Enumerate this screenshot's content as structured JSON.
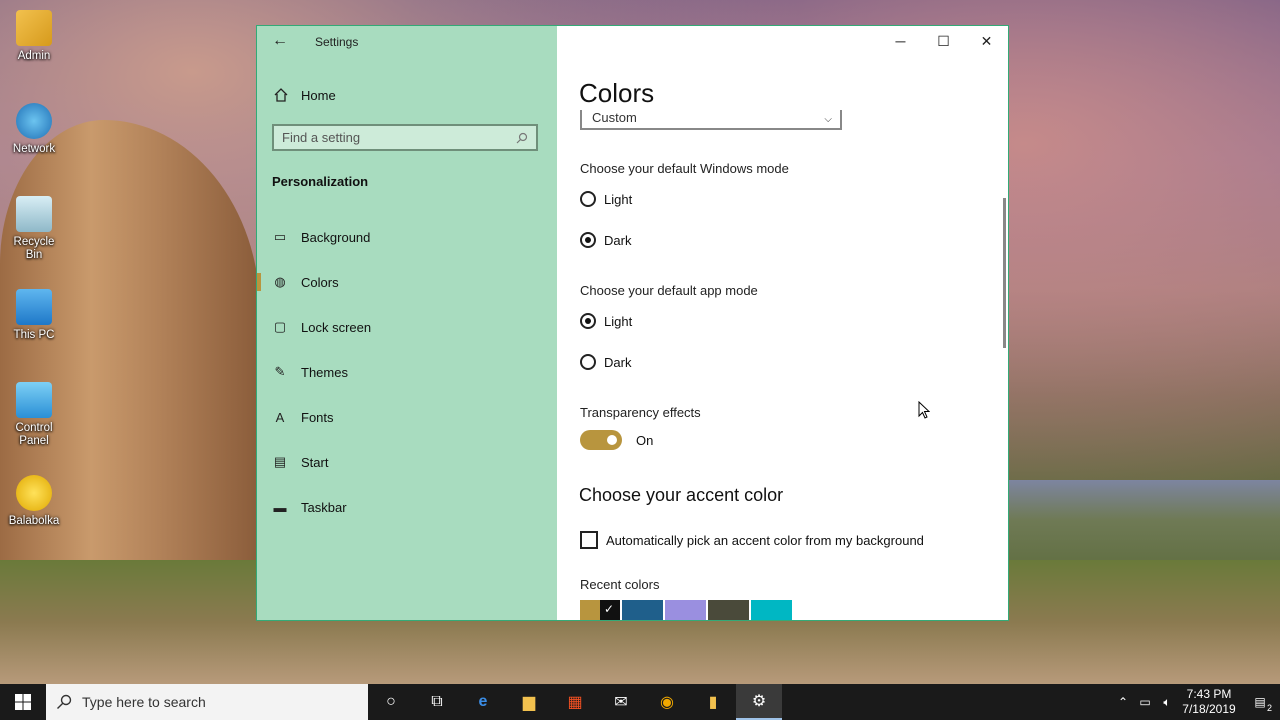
{
  "desktop": {
    "icons": [
      {
        "label": "Admin"
      },
      {
        "label": "Network"
      },
      {
        "label": "Recycle Bin"
      },
      {
        "label": "This PC"
      },
      {
        "label": "Control Panel"
      },
      {
        "label": "Balabolka"
      }
    ]
  },
  "window": {
    "title": "Settings",
    "sidebar": {
      "home_label": "Home",
      "search_placeholder": "Find a setting",
      "section_title": "Personalization",
      "items": [
        {
          "label": "Background",
          "icon": "image-icon"
        },
        {
          "label": "Colors",
          "icon": "palette-icon",
          "active": true
        },
        {
          "label": "Lock screen",
          "icon": "lock-screen-icon"
        },
        {
          "label": "Themes",
          "icon": "brush-icon"
        },
        {
          "label": "Fonts",
          "icon": "font-icon"
        },
        {
          "label": "Start",
          "icon": "start-icon"
        },
        {
          "label": "Taskbar",
          "icon": "taskbar-icon"
        }
      ]
    },
    "main": {
      "heading": "Colors",
      "dropdown_value": "Custom",
      "windows_mode": {
        "label": "Choose your default Windows mode",
        "options": [
          "Light",
          "Dark"
        ],
        "selected": "Dark"
      },
      "app_mode": {
        "label": "Choose your default app mode",
        "options": [
          "Light",
          "Dark"
        ],
        "selected": "Light"
      },
      "transparency": {
        "label": "Transparency effects",
        "state": "On"
      },
      "accent_heading": "Choose your accent color",
      "auto_pick_label": "Automatically pick an accent color from my background",
      "recent_colors_label": "Recent colors",
      "recent_colors": [
        "#b8953e",
        "#111111",
        "#1f5f8b",
        "#9a8fe0",
        "#4a4a3a",
        "#00b7c3"
      ]
    }
  },
  "taskbar": {
    "search_placeholder": "Type here to search",
    "time": "7:43 PM",
    "date": "7/18/2019",
    "notification_count": "2"
  },
  "colors": {
    "accent": "#b8953e",
    "sidebar_bg": "#a8dcbf"
  }
}
